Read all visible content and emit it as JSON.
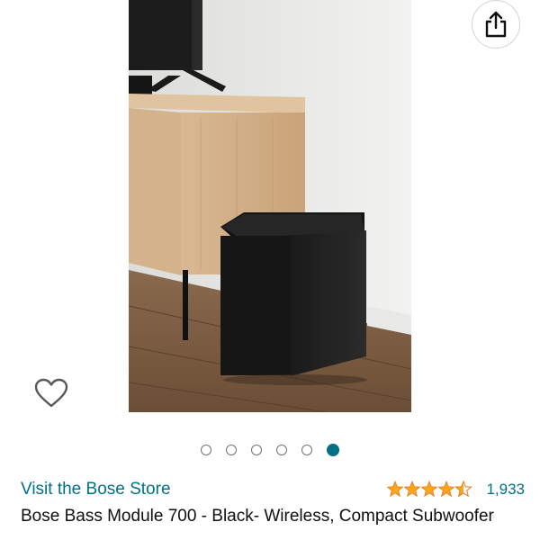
{
  "product": {
    "title": "Bose Bass Module 700 - Black- Wireless, Compact Subwoofer",
    "store_link": "Visit the Bose Store",
    "rating_value": 4.5,
    "rating_count": "1,933"
  },
  "carousel": {
    "total": 6,
    "active_index": 5
  },
  "colors": {
    "link": "#007185",
    "star": "#ffa41c",
    "text": "#0f1111"
  },
  "icons": {
    "share": "share-icon",
    "wishlist": "heart-outline-icon"
  }
}
